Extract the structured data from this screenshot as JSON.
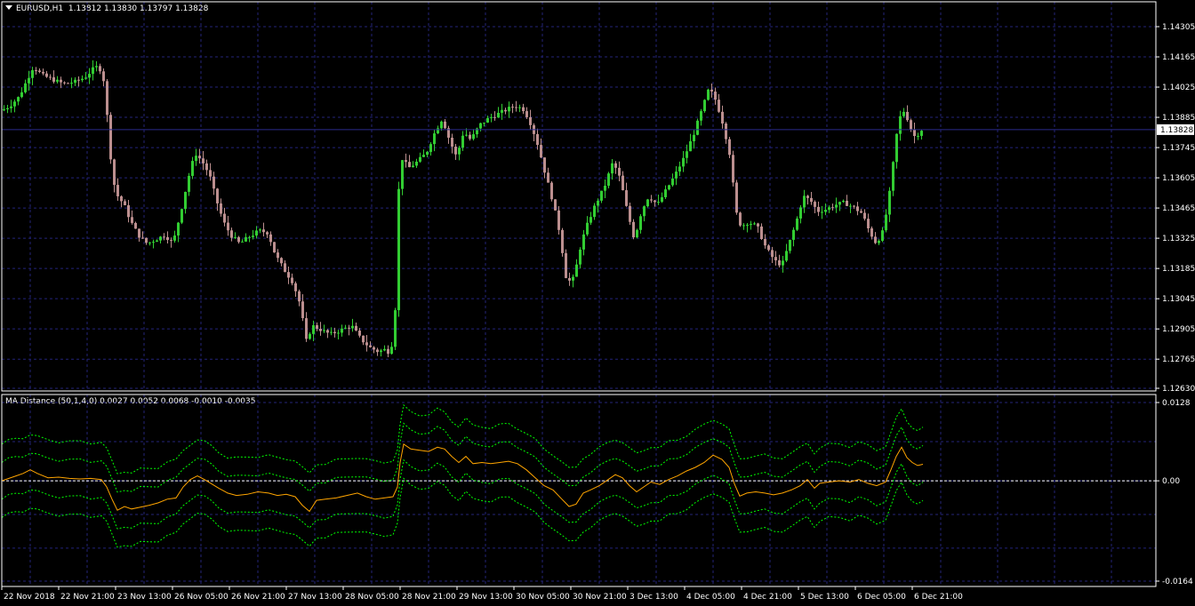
{
  "colors": {
    "background": "#000000",
    "grid": "#232379",
    "frame": "#ffffff",
    "bull": "#32cd32",
    "bear": "#bc8f8f",
    "ma_line": "#ffa500",
    "bands": "#00ff00",
    "bid_line": "#2b2b8c"
  },
  "main_header": {
    "dropdown_icon": "triangle-down-icon",
    "symbol": "EURUSD,H1",
    "ohlc": "1.13812 1.13830 1.13797 1.13828"
  },
  "indicator_header": {
    "label": "MA Distance (50,1,4,0) 0.0027 0.0052 0.0068 -0.0010 -0.0035"
  },
  "chart_data": [
    {
      "type": "candlestick",
      "title": "EURUSD,H1",
      "ylim": [
        1.1263,
        1.14305
      ],
      "yticks": [
        "1.14305",
        "1.14165",
        "1.14025",
        "1.13885",
        "1.13745",
        "1.13605",
        "1.13465",
        "1.13325",
        "1.13185",
        "1.13045",
        "1.12905",
        "1.12765",
        "1.12630"
      ],
      "current_price_label": "1.13828",
      "current_price": 1.13828,
      "close_path": [
        [
          0,
          1.1391
        ],
        [
          12,
          1.1394
        ],
        [
          22,
          1.1398
        ],
        [
          30,
          1.1405
        ],
        [
          38,
          1.1412
        ],
        [
          48,
          1.1408
        ],
        [
          60,
          1.1406
        ],
        [
          72,
          1.1404
        ],
        [
          85,
          1.1405
        ],
        [
          96,
          1.1407
        ],
        [
          108,
          1.1412
        ],
        [
          116,
          1.141
        ],
        [
          122,
          1.1385
        ],
        [
          127,
          1.136
        ],
        [
          133,
          1.1352
        ],
        [
          140,
          1.1348
        ],
        [
          148,
          1.134
        ],
        [
          156,
          1.1334
        ],
        [
          166,
          1.133
        ],
        [
          176,
          1.1332
        ],
        [
          186,
          1.1334
        ],
        [
          195,
          1.133
        ],
        [
          204,
          1.1345
        ],
        [
          212,
          1.136
        ],
        [
          220,
          1.1372
        ],
        [
          228,
          1.1368
        ],
        [
          236,
          1.1362
        ],
        [
          244,
          1.135
        ],
        [
          252,
          1.134
        ],
        [
          260,
          1.1334
        ],
        [
          270,
          1.133
        ],
        [
          280,
          1.1333
        ],
        [
          292,
          1.1336
        ],
        [
          302,
          1.1335
        ],
        [
          310,
          1.1325
        ],
        [
          320,
          1.1318
        ],
        [
          330,
          1.1312
        ],
        [
          338,
          1.1302
        ],
        [
          345,
          1.1285
        ],
        [
          352,
          1.1292
        ],
        [
          362,
          1.129
        ],
        [
          372,
          1.1288
        ],
        [
          384,
          1.129
        ],
        [
          396,
          1.1292
        ],
        [
          406,
          1.1286
        ],
        [
          416,
          1.1282
        ],
        [
          426,
          1.128
        ],
        [
          434,
          1.1281
        ],
        [
          440,
          1.1279
        ],
        [
          445,
          1.13
        ],
        [
          448,
          1.135
        ],
        [
          452,
          1.137
        ],
        [
          460,
          1.1365
        ],
        [
          470,
          1.1368
        ],
        [
          480,
          1.1372
        ],
        [
          490,
          1.1382
        ],
        [
          498,
          1.1388
        ],
        [
          506,
          1.1378
        ],
        [
          514,
          1.137
        ],
        [
          522,
          1.1382
        ],
        [
          530,
          1.1378
        ],
        [
          540,
          1.1385
        ],
        [
          550,
          1.1388
        ],
        [
          560,
          1.139
        ],
        [
          570,
          1.1392
        ],
        [
          580,
          1.1394
        ],
        [
          590,
          1.1392
        ],
        [
          598,
          1.1385
        ],
        [
          606,
          1.1375
        ],
        [
          614,
          1.1362
        ],
        [
          622,
          1.135
        ],
        [
          630,
          1.1335
        ],
        [
          638,
          1.1312
        ],
        [
          646,
          1.1314
        ],
        [
          654,
          1.133
        ],
        [
          662,
          1.134
        ],
        [
          670,
          1.1348
        ],
        [
          680,
          1.1356
        ],
        [
          690,
          1.1368
        ],
        [
          698,
          1.136
        ],
        [
          706,
          1.1345
        ],
        [
          714,
          1.1332
        ],
        [
          722,
          1.1345
        ],
        [
          730,
          1.1352
        ],
        [
          740,
          1.1348
        ],
        [
          750,
          1.1355
        ],
        [
          760,
          1.1362
        ],
        [
          770,
          1.137
        ],
        [
          780,
          1.138
        ],
        [
          790,
          1.1392
        ],
        [
          798,
          1.1402
        ],
        [
          806,
          1.1396
        ],
        [
          814,
          1.1385
        ],
        [
          822,
          1.137
        ],
        [
          828,
          1.1345
        ],
        [
          834,
          1.1338
        ],
        [
          842,
          1.134
        ],
        [
          852,
          1.1338
        ],
        [
          862,
          1.1328
        ],
        [
          872,
          1.1322
        ],
        [
          880,
          1.132
        ],
        [
          888,
          1.133
        ],
        [
          896,
          1.134
        ],
        [
          904,
          1.1352
        ],
        [
          912,
          1.135
        ],
        [
          920,
          1.1345
        ],
        [
          930,
          1.1346
        ],
        [
          940,
          1.1348
        ],
        [
          950,
          1.1349
        ],
        [
          960,
          1.1347
        ],
        [
          970,
          1.1344
        ],
        [
          978,
          1.1336
        ],
        [
          986,
          1.133
        ],
        [
          994,
          1.1336
        ],
        [
          1002,
          1.1356
        ],
        [
          1008,
          1.1378
        ],
        [
          1012,
          1.1388
        ],
        [
          1018,
          1.1392
        ],
        [
          1024,
          1.1384
        ],
        [
          1030,
          1.1379
        ],
        [
          1036,
          1.13828
        ]
      ]
    },
    {
      "type": "line",
      "title": "MA Distance (50,1,4,0)",
      "ylim": [
        -0.0164,
        0.0128
      ],
      "yticks": [
        "0.0128",
        "0.00",
        "-0.0164"
      ],
      "zero_label": "0.00",
      "series": [
        {
          "role": "main",
          "points": [
            [
              0,
              0.0
            ],
            [
              8,
              0.0004
            ],
            [
              16,
              0.0008
            ],
            [
              24,
              0.0012
            ],
            [
              32,
              0.0018
            ],
            [
              40,
              0.0012
            ],
            [
              52,
              0.0005
            ],
            [
              64,
              0.0006
            ],
            [
              76,
              0.0004
            ],
            [
              88,
              0.0003
            ],
            [
              100,
              0.0004
            ],
            [
              112,
              0.0002
            ],
            [
              118,
              -0.001
            ],
            [
              124,
              -0.003
            ],
            [
              130,
              -0.0048
            ],
            [
              138,
              -0.0042
            ],
            [
              146,
              -0.0046
            ],
            [
              156,
              -0.0043
            ],
            [
              166,
              -0.004
            ],
            [
              176,
              -0.0036
            ],
            [
              186,
              -0.003
            ],
            [
              196,
              -0.0028
            ],
            [
              204,
              -0.001
            ],
            [
              212,
              0.0002
            ],
            [
              220,
              0.0008
            ],
            [
              228,
              0.0002
            ],
            [
              236,
              -0.0005
            ],
            [
              244,
              -0.0012
            ],
            [
              254,
              -0.002
            ],
            [
              264,
              -0.0024
            ],
            [
              276,
              -0.0022
            ],
            [
              288,
              -0.0018
            ],
            [
              300,
              -0.002
            ],
            [
              310,
              -0.0024
            ],
            [
              320,
              -0.0022
            ],
            [
              330,
              -0.0026
            ],
            [
              338,
              -0.004
            ],
            [
              346,
              -0.005
            ],
            [
              354,
              -0.0032
            ],
            [
              364,
              -0.003
            ],
            [
              376,
              -0.0028
            ],
            [
              388,
              -0.0024
            ],
            [
              400,
              -0.002
            ],
            [
              410,
              -0.0026
            ],
            [
              420,
              -0.003
            ],
            [
              430,
              -0.0028
            ],
            [
              440,
              -0.0026
            ],
            [
              445,
              -0.001
            ],
            [
              448,
              0.003
            ],
            [
              452,
              0.006
            ],
            [
              460,
              0.0052
            ],
            [
              470,
              0.005
            ],
            [
              480,
              0.0048
            ],
            [
              490,
              0.0055
            ],
            [
              498,
              0.0052
            ],
            [
              506,
              0.004
            ],
            [
              514,
              0.003
            ],
            [
              522,
              0.004
            ],
            [
              530,
              0.0028
            ],
            [
              540,
              0.003
            ],
            [
              550,
              0.0028
            ],
            [
              560,
              0.003
            ],
            [
              570,
              0.0032
            ],
            [
              580,
              0.0028
            ],
            [
              590,
              0.0018
            ],
            [
              600,
              0.0005
            ],
            [
              610,
              -0.0008
            ],
            [
              620,
              -0.0015
            ],
            [
              630,
              -0.003
            ],
            [
              638,
              -0.0042
            ],
            [
              646,
              -0.0038
            ],
            [
              654,
              -0.002
            ],
            [
              662,
              -0.0015
            ],
            [
              672,
              -0.0008
            ],
            [
              682,
              0.0002
            ],
            [
              690,
              0.001
            ],
            [
              698,
              0.0005
            ],
            [
              706,
              -0.0008
            ],
            [
              714,
              -0.0018
            ],
            [
              722,
              -0.001
            ],
            [
              730,
              -0.0002
            ],
            [
              740,
              -0.0006
            ],
            [
              750,
              0.0002
            ],
            [
              760,
              0.0008
            ],
            [
              770,
              0.0016
            ],
            [
              780,
              0.0022
            ],
            [
              790,
              0.003
            ],
            [
              800,
              0.0042
            ],
            [
              810,
              0.0035
            ],
            [
              818,
              0.0022
            ],
            [
              824,
              -0.0005
            ],
            [
              830,
              -0.0025
            ],
            [
              838,
              -0.002
            ],
            [
              848,
              -0.0018
            ],
            [
              858,
              -0.002
            ],
            [
              868,
              -0.0023
            ],
            [
              878,
              -0.002
            ],
            [
              888,
              -0.0015
            ],
            [
              898,
              -0.0008
            ],
            [
              906,
              0.0002
            ],
            [
              914,
              -0.0012
            ],
            [
              920,
              -0.0004
            ],
            [
              930,
              -0.0002
            ],
            [
              942,
              0.0
            ],
            [
              954,
              -0.0002
            ],
            [
              964,
              0.0002
            ],
            [
              974,
              -0.0004
            ],
            [
              984,
              -0.0008
            ],
            [
              994,
              -0.0002
            ],
            [
              1000,
              0.0018
            ],
            [
              1006,
              0.004
            ],
            [
              1012,
              0.0055
            ],
            [
              1018,
              0.0038
            ],
            [
              1024,
              0.003
            ],
            [
              1030,
              0.0025
            ],
            [
              1036,
              0.0027
            ]
          ]
        },
        {
          "role": "band",
          "offset": 0.006
        },
        {
          "role": "band",
          "offset": 0.003
        },
        {
          "role": "band",
          "offset": -0.003
        },
        {
          "role": "band",
          "offset": -0.006
        }
      ]
    }
  ],
  "x_axis": {
    "tick_labels": [
      [
        "22 Nov 2018",
        0
      ],
      [
        "22 Nov 21:00",
        64
      ],
      [
        "23 Nov 13:00",
        128
      ],
      [
        "26 Nov 05:00",
        192
      ],
      [
        "26 Nov 21:00",
        256
      ],
      [
        "27 Nov 13:00",
        320
      ],
      [
        "28 Nov 05:00",
        384
      ],
      [
        "28 Nov 21:00",
        448
      ],
      [
        "29 Nov 13:00",
        512
      ],
      [
        "30 Nov 05:00",
        576
      ],
      [
        "30 Nov 21:00",
        640
      ],
      [
        "3 Dec 13:00",
        704
      ],
      [
        "4 Dec 05:00",
        768
      ],
      [
        "4 Dec 21:00",
        832
      ],
      [
        "5 Dec 13:00",
        896
      ],
      [
        "6 Dec 05:00",
        960
      ],
      [
        "6 Dec 21:00",
        1024
      ]
    ]
  }
}
